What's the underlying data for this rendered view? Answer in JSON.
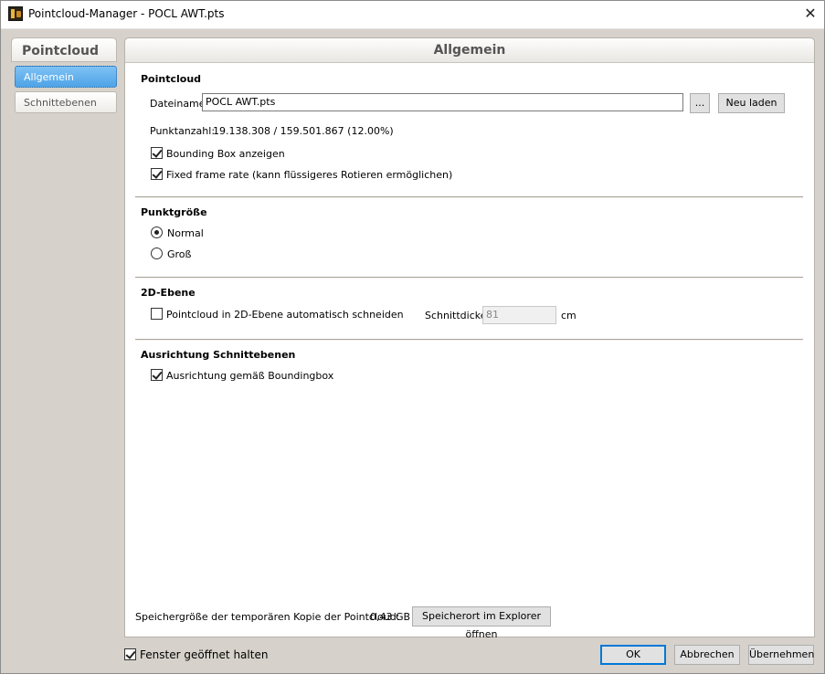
{
  "window": {
    "title": "Pointcloud-Manager - POCL AWT.pts",
    "close_glyph": "✕",
    "icon": "app-icon"
  },
  "nav": {
    "header": "Pointcloud",
    "items": [
      {
        "label": "Allgemein",
        "active": true
      },
      {
        "label": "Schnittebenen",
        "active": false
      }
    ]
  },
  "panel": {
    "title": "Allgemein"
  },
  "pointcloud": {
    "section_title": "Pointcloud",
    "filename_label": "Dateiname",
    "filename_value": "POCL AWT.pts",
    "browse_label": "...",
    "reload_label": "Neu laden",
    "count_label": "Punktanzahl:",
    "count_value": "19.138.308 / 159.501.867 (12.00%)",
    "bbox_label": "Bounding Box anzeigen",
    "bbox_checked": true,
    "fixed_frame_label": "Fixed frame rate (kann flüssigeres Rotieren ermöglichen)",
    "fixed_frame_checked": true
  },
  "point_size": {
    "section_title": "Punktgröße",
    "options": [
      {
        "label": "Normal",
        "selected": true
      },
      {
        "label": "Groß",
        "selected": false
      }
    ]
  },
  "plane2d": {
    "section_title": "2D-Ebene",
    "auto_cut_label": "Pointcloud in 2D-Ebene automatisch schneiden",
    "auto_cut_checked": false,
    "thickness_label": "Schnittdicke",
    "thickness_value": "81",
    "unit": "cm"
  },
  "alignment": {
    "section_title": "Ausrichtung Schnittebenen",
    "bbox_align_label": "Ausrichtung gemäß Boundingbox",
    "bbox_align_checked": true
  },
  "storage": {
    "label": "Speichergröße der temporären Kopie der Pointcloud:",
    "value": "0,43 GB",
    "open_button": "Speicherort im Explorer öffnen"
  },
  "footer": {
    "keep_open_label": "Fenster geöffnet halten",
    "keep_open_checked": true,
    "ok_label": "OK",
    "cancel_label": "Abbrechen",
    "apply_label": "Übernehmen"
  }
}
